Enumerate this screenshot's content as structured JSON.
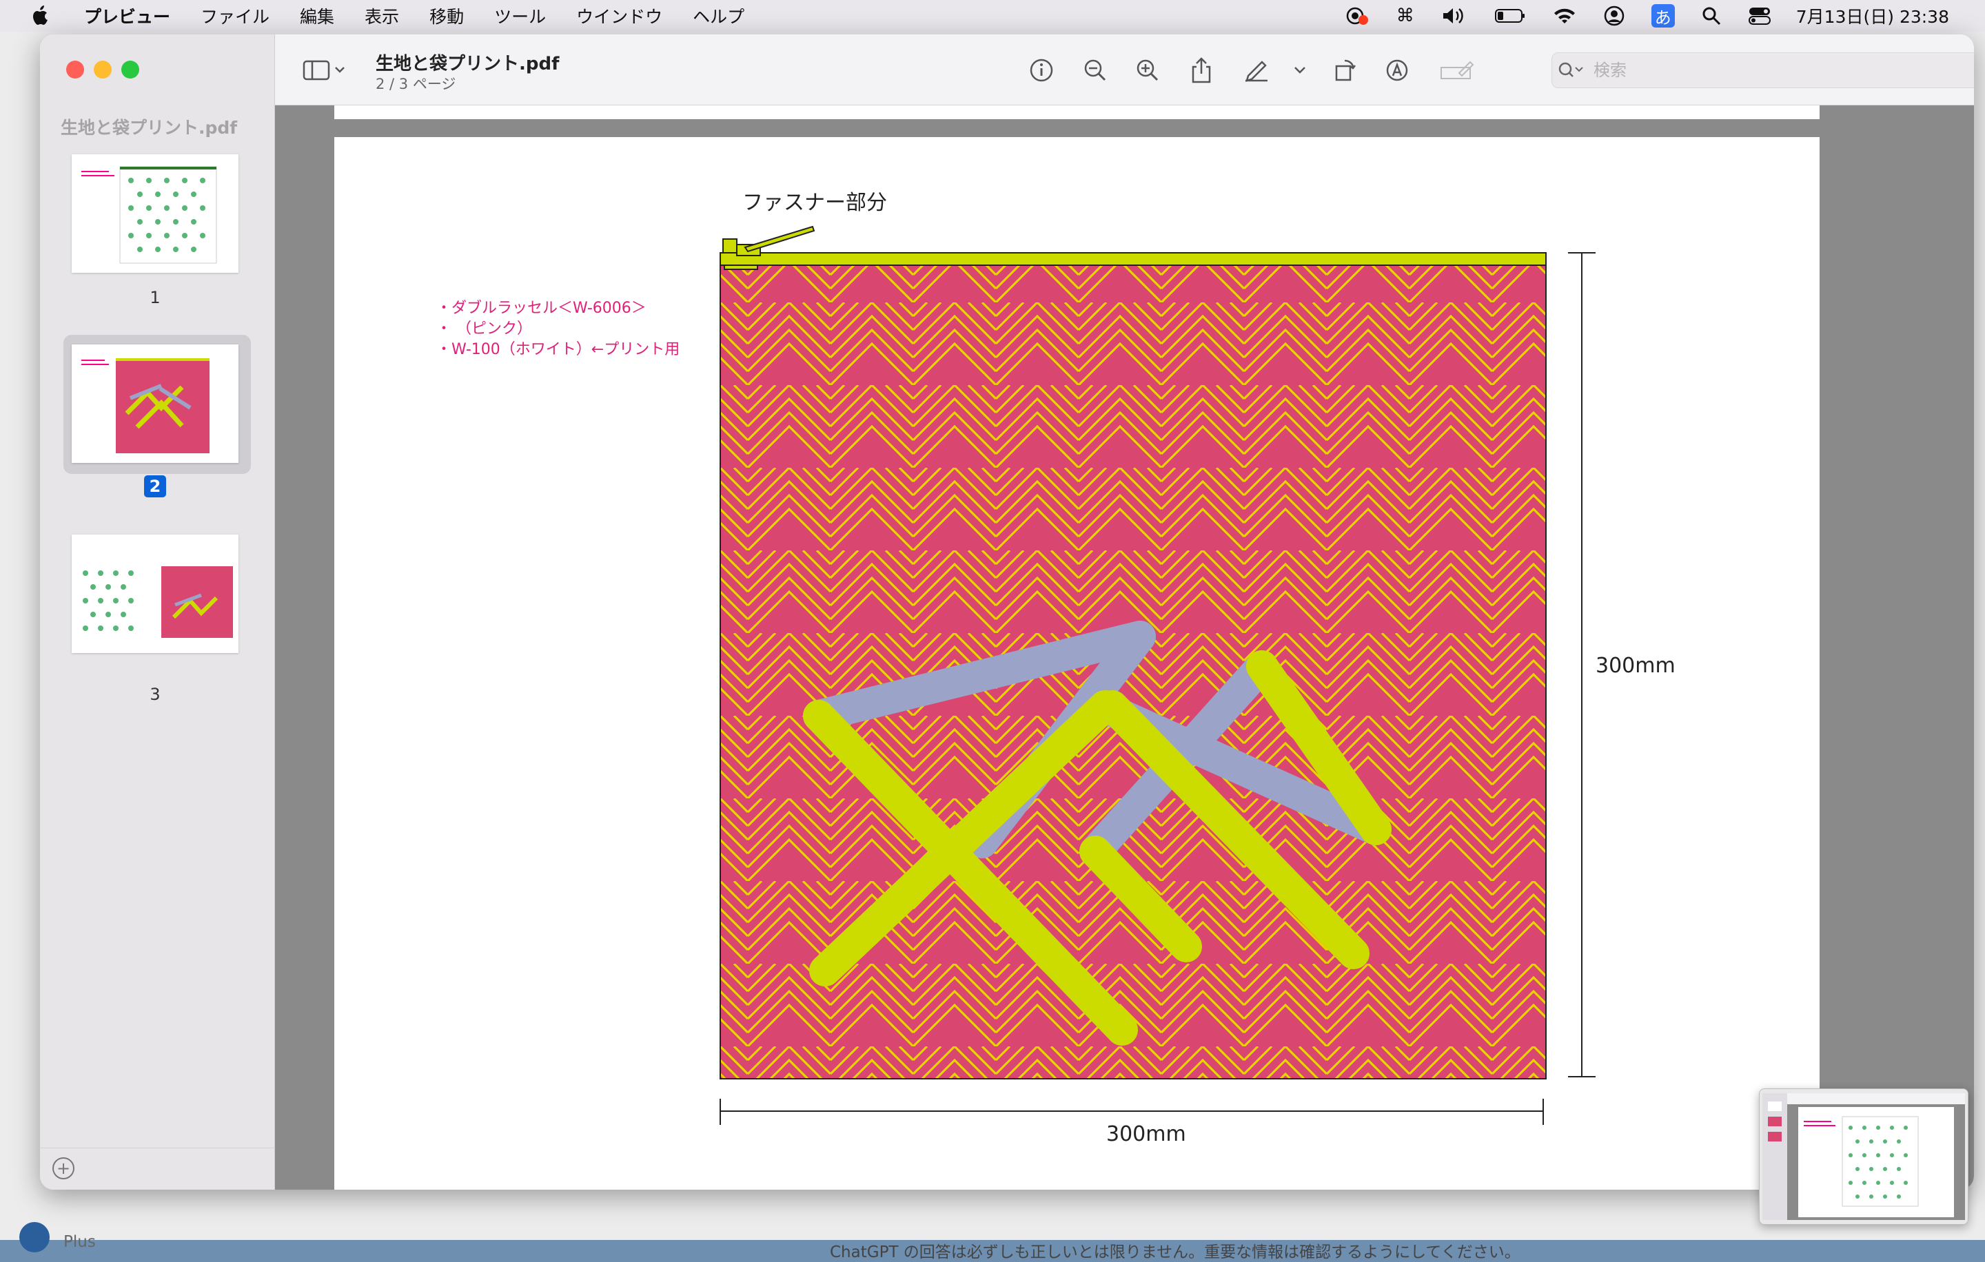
{
  "menubar": {
    "app_name": "プレビュー",
    "items": [
      "ファイル",
      "編集",
      "表示",
      "移動",
      "ツール",
      "ウインドウ",
      "ヘルプ"
    ],
    "ime_label": "あ",
    "clock": "7月13日(日) 23:38"
  },
  "background_window": {
    "footer_notice": "ChatGPT の回答は必ずしも正しいとは限りません。重要な情報は確認するようにしてください。",
    "plan_label": "Plus"
  },
  "sidebar": {
    "filename": "生地と袋プリント.pdf",
    "pages": [
      {
        "number": "1",
        "selected": false
      },
      {
        "number": "2",
        "selected": true
      },
      {
        "number": "3",
        "selected": false
      }
    ]
  },
  "toolbar": {
    "title": "生地と袋プリント.pdf",
    "subtitle": "2 / 3 ページ",
    "search_placeholder": "検索"
  },
  "document": {
    "zipper_label": "ファスナー部分",
    "notes": [
      "・ダブルラッセル＜W-6006＞",
      "・ （ピンク）",
      "・W-100（ホワイト）←プリント用"
    ],
    "height_label": "300mm",
    "width_label": "300mm"
  },
  "colors": {
    "fabric_pink": "#d9466f",
    "stripe_yellow": "#e8d400",
    "strap_yellow": "#cddc00",
    "strap_gray": "#9ba4c8",
    "note_pink": "#e0207a"
  }
}
